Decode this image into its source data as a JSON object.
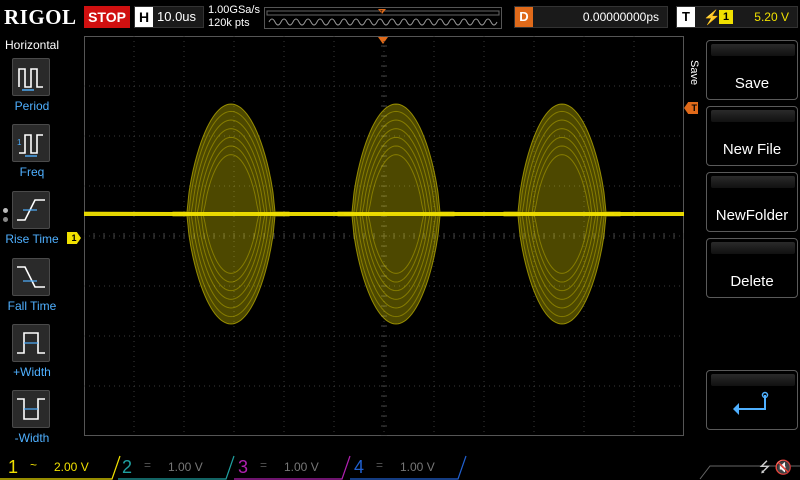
{
  "top": {
    "brand": "RIGOL",
    "run_state": "STOP",
    "timebase_label": "H",
    "timebase_value": "10.0us",
    "sample_rate": "1.00GSa/s",
    "memory_depth": "120k pts",
    "delay_label": "D",
    "delay_value": "0.00000000ps",
    "trigger_label": "T",
    "trigger_source": "1",
    "trigger_level": "5.20 V"
  },
  "left_panel": {
    "title": "Horizontal",
    "items": [
      {
        "label": "Period",
        "icon": "period-icon"
      },
      {
        "label": "Freq",
        "icon": "frequency-icon"
      },
      {
        "label": "Rise Time",
        "icon": "rise-time-icon"
      },
      {
        "label": "Fall Time",
        "icon": "fall-time-icon"
      },
      {
        "label": "+Width",
        "icon": "positive-width-icon"
      },
      {
        "label": "-Width",
        "icon": "negative-width-icon"
      }
    ]
  },
  "waveform": {
    "ch1_marker": "1",
    "trigger_marker": "T",
    "trace_color": "#f0e000",
    "accent_color": "#e06a1a"
  },
  "right_menu": {
    "tab": "Save",
    "buttons": [
      {
        "label": "Save"
      },
      {
        "label": "New File"
      },
      {
        "label": "NewFolder"
      },
      {
        "label": "Delete"
      }
    ],
    "return_icon": "return-arrow-icon"
  },
  "bottom": {
    "channels": [
      {
        "num": "1",
        "coupling": "~",
        "scale": "2.00 V",
        "color": "#f0e000",
        "active": true
      },
      {
        "num": "2",
        "coupling": "=",
        "scale": "1.00 V",
        "color": "#1fa0a0",
        "active": false
      },
      {
        "num": "3",
        "coupling": "=",
        "scale": "1.00 V",
        "color": "#b020b0",
        "active": false
      },
      {
        "num": "4",
        "coupling": "=",
        "scale": "1.00 V",
        "color": "#2060d0",
        "active": false
      }
    ],
    "status_icons": [
      "usb-icon",
      "speaker-muted-icon"
    ]
  }
}
